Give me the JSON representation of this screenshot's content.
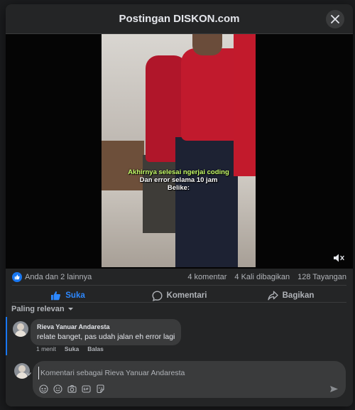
{
  "modal": {
    "title": "Postingan DISKON.com"
  },
  "video": {
    "caption_line1": "Akhirnya selesai ngerjai coding",
    "caption_line2": "Dan error selama 10 jam",
    "caption_line3": "Belike:",
    "muted": true
  },
  "stats": {
    "reactions_text": "Anda dan 2 lainnya",
    "comments": "4 komentar",
    "shares": "4 Kali dibagikan",
    "views": "128 Tayangan"
  },
  "actions": {
    "like": "Suka",
    "comment": "Komentari",
    "share": "Bagikan"
  },
  "comments_section": {
    "sort_label": "Paling relevan",
    "items": [
      {
        "author": "Rieva Yanuar Andaresta",
        "text": "relate banget, pas udah jalan eh error lagi",
        "time": "1 menit",
        "like_label": "Suka",
        "reply_label": "Balas"
      }
    ]
  },
  "composer": {
    "placeholder": "Komentari sebagai Rieva Yanuar Andaresta",
    "value": ""
  },
  "icons": [
    "close-icon",
    "mute-icon",
    "like-icon",
    "comment-icon",
    "share-icon",
    "chevron-down-icon",
    "avatar-icon",
    "sticker-icon",
    "emoji-icon",
    "camera-icon",
    "gif-icon",
    "avatar-sticker-icon",
    "send-icon"
  ],
  "colors": {
    "accent": "#1877f2",
    "liked": "#2d88ff",
    "panel": "#242526",
    "surface": "#3a3b3c"
  }
}
